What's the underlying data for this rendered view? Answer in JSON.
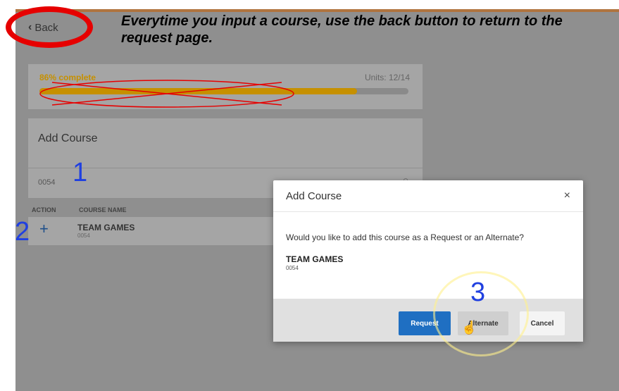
{
  "screen": {
    "back_label": "Back",
    "progress": {
      "label": "86% complete",
      "value": 0.86,
      "units": "Units: 12/14"
    },
    "add_course_title": "Add Course",
    "search_value": "0054",
    "table": {
      "headers": [
        "ACTION",
        "COURSE NAME"
      ],
      "rows": [
        {
          "action_icon": "plus-icon",
          "name": "TEAM GAMES",
          "code": "0054"
        }
      ]
    }
  },
  "modal": {
    "title": "Add Course",
    "close_glyph": "×",
    "question": "Would you like to add this course as a Request or an Alternate?",
    "course_name": "TEAM GAMES",
    "course_code": "0054",
    "buttons": {
      "request": "Request",
      "alternate": "Alternate",
      "cancel": "Cancel"
    }
  },
  "annotations": {
    "instruction": "Everytime you input a course, use the back button to return to the  request page.",
    "step_numbers": [
      "1",
      "2",
      "3"
    ],
    "colors": {
      "circle": "#e60000",
      "numbers": "#2040e0",
      "progress": "#c69000",
      "request_button": "#1f6fc2"
    }
  }
}
